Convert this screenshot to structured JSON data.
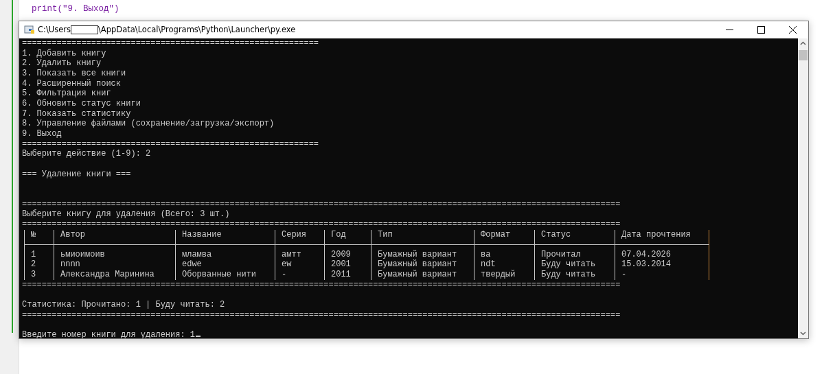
{
  "editor": {
    "code_lines": [
      "print(\"9. Выход\")"
    ]
  },
  "window": {
    "title_prefix": "C:\\Users",
    "title_suffix": "\\AppData\\Local\\Programs\\Python\\Launcher\\py.exe"
  },
  "console": {
    "lines": [
      {
        "kind": "text",
        "text": "============================================================"
      },
      {
        "kind": "text",
        "text": "1. Добавить книгу"
      },
      {
        "kind": "text",
        "text": "2. Удалить книгу"
      },
      {
        "kind": "text",
        "text": "3. Показать все книги"
      },
      {
        "kind": "text",
        "text": "4. Расширенный поиск"
      },
      {
        "kind": "text",
        "text": "5. Фильтрация книг"
      },
      {
        "kind": "text",
        "text": "6. Обновить статус книги"
      },
      {
        "kind": "text",
        "text": "7. Показать статистику"
      },
      {
        "kind": "text",
        "text": "8. Управление файлами (сохранение/загрузка/экспорт)"
      },
      {
        "kind": "text",
        "text": "9. Выход"
      },
      {
        "kind": "text",
        "text": "============================================================"
      },
      {
        "kind": "text",
        "text": "Выберите действие (1-9): 2"
      },
      {
        "kind": "blank"
      },
      {
        "kind": "text",
        "text": "=== Удаление книги ==="
      },
      {
        "kind": "blank"
      },
      {
        "kind": "blank"
      },
      {
        "kind": "text",
        "text": "========================================================================================================================="
      },
      {
        "kind": "text",
        "text": "Выберите книгу для удаления (Всего: 3 шт.)"
      },
      {
        "kind": "text",
        "text": "========================================================================================================================="
      },
      {
        "kind": "table",
        "columns": [
          "№",
          "Автор",
          "Название",
          "Серия",
          "Год",
          "Тип",
          "Формат",
          "Статус",
          "Дата прочтения"
        ],
        "rows": [
          [
            "1",
            "ьмиоимоив",
            "мламва",
            "амтт",
            "2009",
            "Бумажный вариант",
            "ва",
            "Прочитал",
            "07.04.2026"
          ],
          [
            "2",
            "nnnn",
            "edwe",
            "ew",
            "2001",
            "Бумажный вариант",
            "ndt",
            "Буду читать",
            "15.03.2014"
          ],
          [
            "3",
            "Александра Маринина",
            "Оборванные нити",
            "-",
            "2011",
            "Бумажный вариант",
            "твердый",
            "Буду читать",
            "-"
          ]
        ]
      },
      {
        "kind": "text",
        "text": "========================================================================================================================="
      },
      {
        "kind": "blank"
      },
      {
        "kind": "text",
        "text": "Статистика: Прочитано: 1 | Буду читать: 2"
      },
      {
        "kind": "text",
        "text": "========================================================================================================================="
      },
      {
        "kind": "blank"
      },
      {
        "kind": "input",
        "text": "Введите номер книги для удаления: 1"
      }
    ]
  }
}
